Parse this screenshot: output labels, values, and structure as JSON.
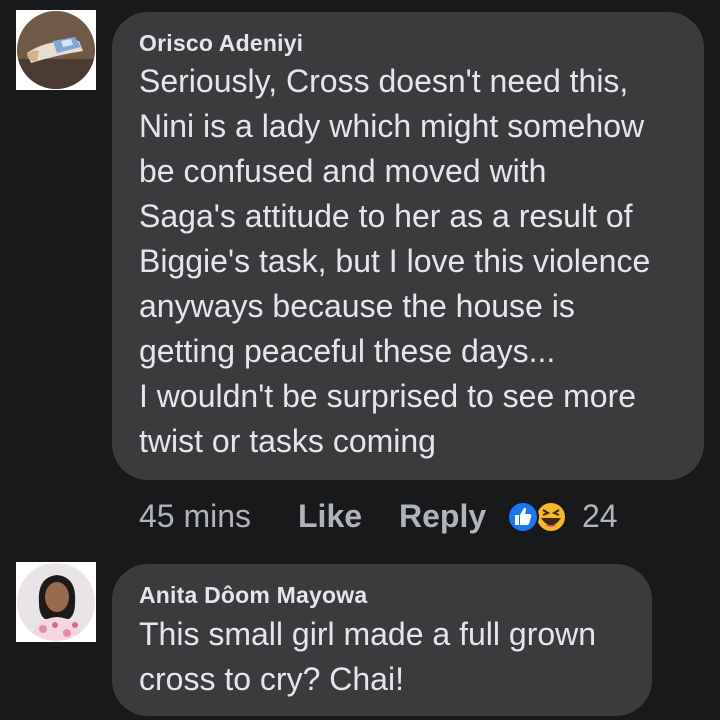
{
  "comments": [
    {
      "author": "Orisco Adeniyi",
      "text": "Seriously, Cross doesn't need this,\nNini is a lady which might somehow\nbe confused and moved with\nSaga's attitude to her as a result of\nBiggie's task, but I love this violence\nanyways because the house is\ngetting peaceful these days...\nI wouldn't be surprised to see more\ntwist or tasks coming",
      "time": "45 mins",
      "like_label": "Like",
      "reply_label": "Reply",
      "reaction_icons": [
        "like-icon",
        "haha-icon"
      ],
      "reaction_count": "24"
    },
    {
      "author": "Anita Dôom Mayowa",
      "text": "This small girl made a full grown\ncross to cry?  Chai!"
    }
  ],
  "colors": {
    "background": "#18191a",
    "bubble": "#3a3b3c",
    "text": "#e4e6eb",
    "meta": "#b0b3b8",
    "like_blue": "#1877f2",
    "haha_yellow": "#f7b928"
  }
}
